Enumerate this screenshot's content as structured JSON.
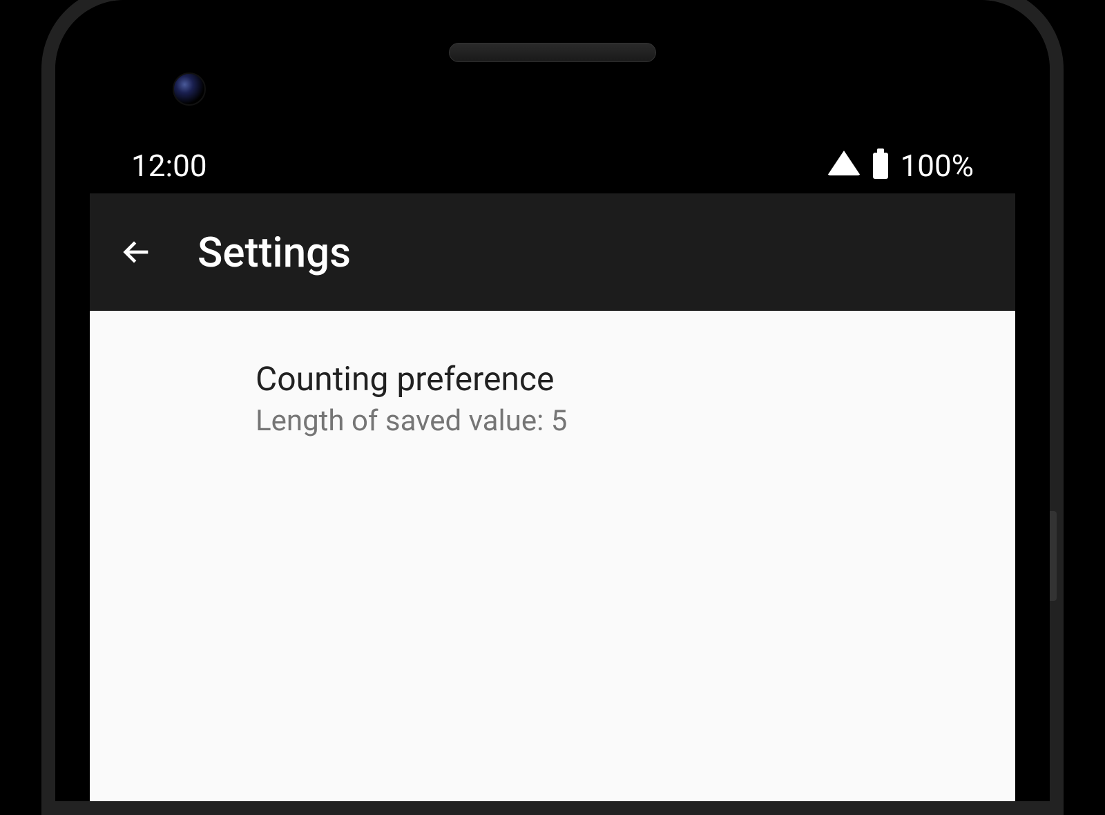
{
  "status_bar": {
    "time": "12:00",
    "battery_percent": "100%"
  },
  "app_bar": {
    "title": "Settings"
  },
  "preferences": [
    {
      "title": "Counting preference",
      "summary": "Length of saved value: 5"
    }
  ]
}
